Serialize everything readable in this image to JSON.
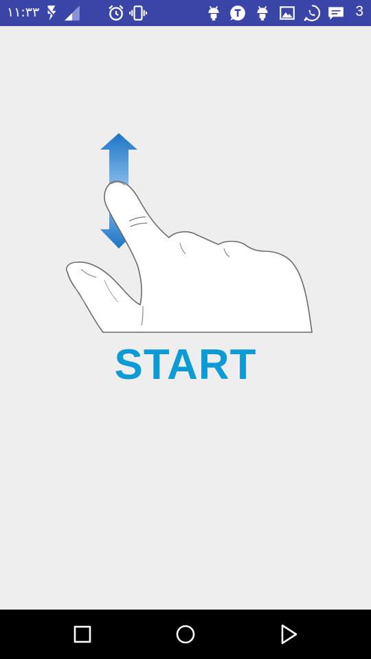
{
  "status_bar": {
    "time": "١١:٣٣",
    "right_text": "3",
    "icons": [
      "flash-off-icon",
      "signal-icon",
      "alarm-icon",
      "vibrate-icon",
      "android-icon",
      "telegram-icon",
      "android-icon",
      "gallery-icon",
      "whatsapp-icon",
      "message-icon"
    ],
    "color": "#3b45a8"
  },
  "main": {
    "gesture_image": "swipe-up-down-hand-icon",
    "start_label": "START",
    "label_color": "#0d9bd6",
    "background": "#eeeeee"
  },
  "nav_bar": {
    "buttons": [
      "recents-button",
      "home-button",
      "back-button"
    ]
  }
}
